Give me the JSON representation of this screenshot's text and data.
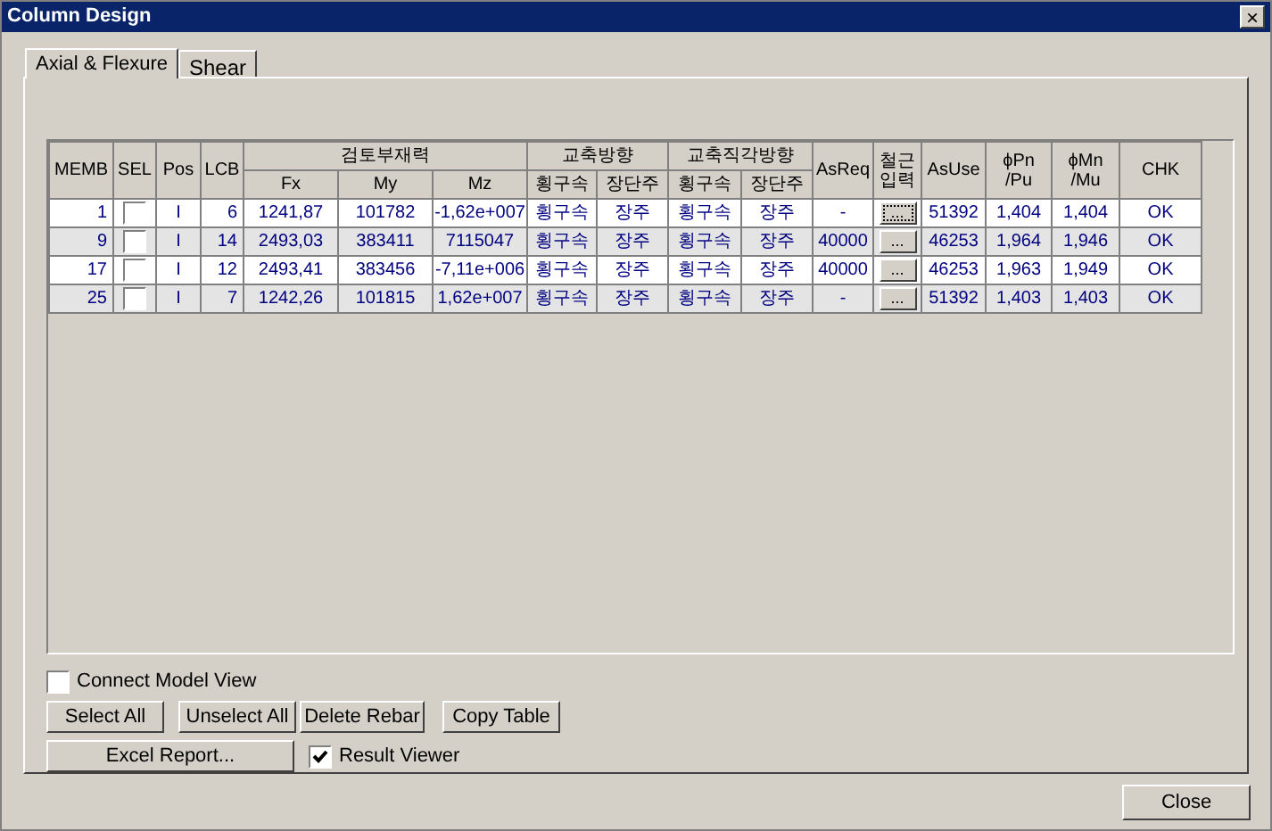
{
  "window": {
    "title": "Column Design",
    "close": "×"
  },
  "tabs": [
    {
      "label": "Axial & Flexure",
      "selected": true
    },
    {
      "label": "Shear",
      "selected": false
    }
  ],
  "table": {
    "columns": [
      "MEMB",
      "SEL",
      "Pos",
      "LCB",
      "검토부재력",
      "교축방향",
      "교축직각방향",
      "AsReq",
      "철근입력",
      "AsUse",
      "ϕPn\n/Pu",
      "ϕMn\n/Mu",
      "CHK"
    ],
    "subcolumns": [
      "Fx",
      "My",
      "Mz",
      "횡구속",
      "장단주",
      "횡구속",
      "장단주"
    ],
    "rows": [
      {
        "memb": "1",
        "sel": false,
        "pos": "I",
        "lcb": "6",
        "fx": "1241,87",
        "my": "101782",
        "mz": "-1,62e+007",
        "b1": "횡구속",
        "b2": "장주",
        "c1": "횡구속",
        "c2": "장주",
        "asreq": "-",
        "rebar": "...",
        "focused": true,
        "asuse": "51392",
        "pn": "1,404",
        "mn": "1,404",
        "chk": "OK"
      },
      {
        "memb": "9",
        "sel": false,
        "pos": "I",
        "lcb": "14",
        "fx": "2493,03",
        "my": "383411",
        "mz": "7115047",
        "b1": "횡구속",
        "b2": "장주",
        "c1": "횡구속",
        "c2": "장주",
        "asreq": "40000",
        "rebar": "...",
        "focused": false,
        "asuse": "46253",
        "pn": "1,964",
        "mn": "1,946",
        "chk": "OK"
      },
      {
        "memb": "17",
        "sel": false,
        "pos": "I",
        "lcb": "12",
        "fx": "2493,41",
        "my": "383456",
        "mz": "-7,11e+006",
        "b1": "횡구속",
        "b2": "장주",
        "c1": "횡구속",
        "c2": "장주",
        "asreq": "40000",
        "rebar": "...",
        "focused": false,
        "asuse": "46253",
        "pn": "1,963",
        "mn": "1,949",
        "chk": "OK"
      },
      {
        "memb": "25",
        "sel": false,
        "pos": "I",
        "lcb": "7",
        "fx": "1242,26",
        "my": "101815",
        "mz": "1,62e+007",
        "b1": "횡구속",
        "b2": "장주",
        "c1": "횡구속",
        "c2": "장주",
        "asreq": "-",
        "rebar": "...",
        "focused": false,
        "asuse": "51392",
        "pn": "1,403",
        "mn": "1,403",
        "chk": "OK"
      }
    ]
  },
  "connect_model_view": {
    "label": "Connect Model View",
    "checked": false
  },
  "buttons": [
    "Select All",
    "Unselect All",
    "Delete Rebar",
    "Copy Table"
  ],
  "excel_button": "Excel Report...",
  "result_viewer": {
    "label": "Result Viewer",
    "checked": true
  },
  "close_button": "Close"
}
